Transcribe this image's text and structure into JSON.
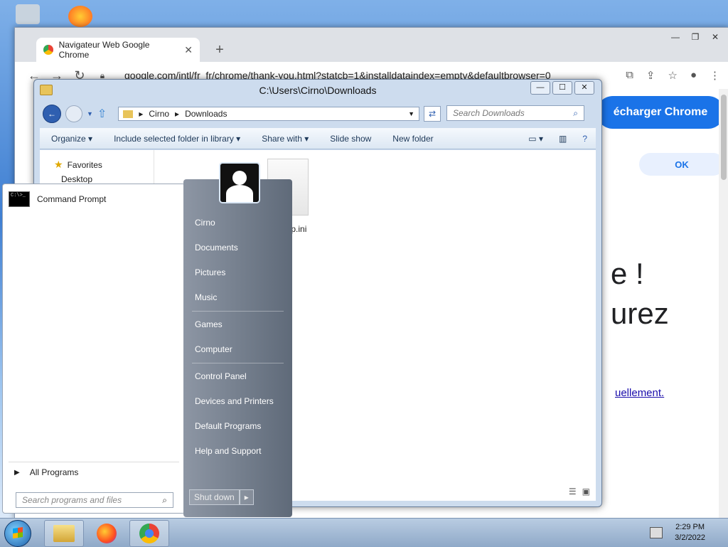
{
  "chrome": {
    "tab_title": "Navigateur Web Google Chrome",
    "tab_close": "✕",
    "new_tab": "+",
    "url": "google.com/intl/fr_fr/chrome/thank-you.html?statcb=1&installdataindex=empty&defaultbrowser=0",
    "download_button": "écharger Chrome",
    "ok_button": "OK",
    "heading_line1": "e !",
    "heading_line2": "urez",
    "link_text": "uellement."
  },
  "explorer": {
    "title": "C:\\Users\\Cirno\\Downloads",
    "breadcrumb": [
      "Cirno",
      "Downloads"
    ],
    "search_placeholder": "Search Downloads",
    "commands": {
      "organize": "Organize",
      "include": "Include selected folder in library",
      "share": "Share with",
      "slideshow": "Slide show",
      "new_folder": "New folder"
    },
    "nav": {
      "favorites": "Favorites",
      "desktop": "Desktop"
    },
    "files": [
      {
        "name": "desktop.ini"
      }
    ]
  },
  "start_menu": {
    "pinned": [
      {
        "label": "Command Prompt"
      }
    ],
    "all_programs": "All Programs",
    "search_placeholder": "Search programs and files",
    "user": "Cirno",
    "right_links": {
      "group1": [
        "Documents",
        "Pictures",
        "Music"
      ],
      "group2": [
        "Games",
        "Computer"
      ],
      "group3": [
        "Control Panel",
        "Devices and Printers",
        "Default Programs",
        "Help and Support"
      ]
    },
    "shutdown": "Shut down"
  },
  "taskbar": {
    "time": "2:29 PM",
    "date": "3/2/2022",
    "pinned_icons": [
      "windows-explorer-icon",
      "firefox-icon",
      "chrome-icon"
    ]
  },
  "colors": {
    "chrome_blue": "#1a73e8",
    "start_accent": "#1d5ea8"
  }
}
